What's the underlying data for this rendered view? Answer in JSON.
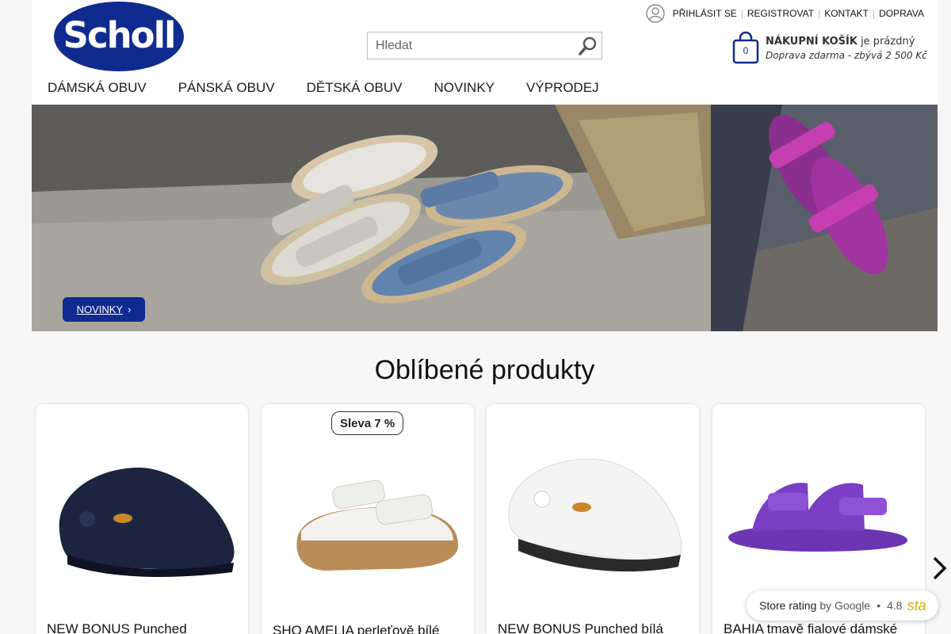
{
  "header": {
    "logo_text": "Scholl",
    "search": {
      "placeholder": "Hledat"
    },
    "top_links": {
      "login": "PŘIHLÁSIT SE",
      "register": "REGISTROVAT",
      "contact": "KONTAKT",
      "shipping": "DOPRAVA"
    },
    "cart": {
      "count": "0",
      "title_bold": "NÁKUPNÍ KOŠÍK",
      "title_rest": " je prázdný",
      "subtitle": "Doprava zdarma - zbývá 2 500 Kč"
    },
    "nav": [
      "DÁMSKÁ OBUV",
      "PÁNSKÁ OBUV",
      "DĚTSKÁ OBUV",
      "NOVINKY",
      "VÝPRODEJ"
    ]
  },
  "banner": {
    "button_label": "NOVINKY",
    "button_chevron": "›"
  },
  "products_section": {
    "title": "Oblíbené produkty",
    "items": [
      {
        "name": "NEW BONUS Punched",
        "badge": "",
        "color": "#1d2440"
      },
      {
        "name": "SHO AMELIA perleťově bílé",
        "badge": "Sleva 7 %",
        "color": "#f2f2ef"
      },
      {
        "name": "NEW BONUS Punched bílá",
        "badge": "",
        "color": "#f4f4f4"
      },
      {
        "name": "BAHIA tmavě fialové dámské",
        "badge": "",
        "color": "#7a3fc4"
      }
    ]
  },
  "rating_widget": {
    "label": "Store rating",
    "by": "by Google",
    "dot": "•",
    "score": "4.8",
    "stars": "sta"
  },
  "colors": {
    "brand_blue": "#0f2b8f",
    "purple_product": "#7a3fc4"
  }
}
